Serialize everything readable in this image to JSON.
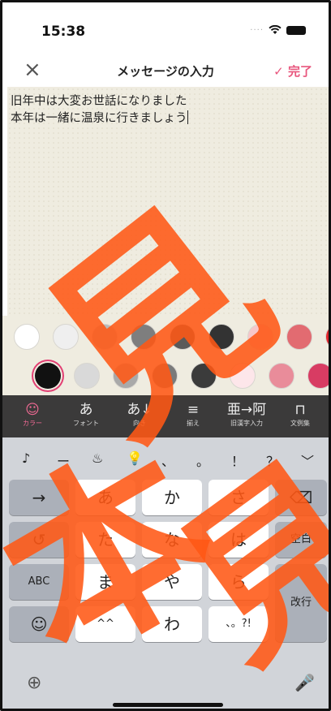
{
  "status_bar": {
    "time": "15:38"
  },
  "nav": {
    "close_icon": "×",
    "title": "メッセージの入力",
    "done_check": "✓",
    "done_label": "完了"
  },
  "editor": {
    "lines": [
      "旧年中は大変お世話になりました",
      "本年は一緒に温泉に行きましょう"
    ]
  },
  "palette": {
    "row1": [
      "#ffffff",
      "#efefef",
      "#b9b9b9",
      "#7e7e7e",
      "#5a5a5a",
      "#333333",
      "#f7c6c9",
      "#e26b71",
      "#e2262c"
    ],
    "row2": [
      "#111111",
      "#d9d9d9",
      "#a9a9a9",
      "#7a7a7a",
      "#3b3b3b",
      "#fde6ea",
      "#e98c9a",
      "#d83c63"
    ],
    "selected_row2_index": 0
  },
  "toolbar": {
    "items": [
      {
        "icon": "palette-icon",
        "glyph": "☺",
        "label": "カラー",
        "active": true
      },
      {
        "icon": "font-icon",
        "glyph": "あ",
        "label": "フォント",
        "active": false
      },
      {
        "icon": "direction-icon",
        "glyph": "あ↓",
        "label": "向き",
        "active": false
      },
      {
        "icon": "align-icon",
        "glyph": "≡",
        "label": "揃え",
        "active": false
      },
      {
        "icon": "kanji-icon",
        "glyph": "亜→阿",
        "label": "旧漢字入力",
        "active": false
      },
      {
        "icon": "dictionary-icon",
        "glyph": "⊓",
        "label": "文例集",
        "active": false
      }
    ]
  },
  "keyboard": {
    "candidates": [
      "♪",
      "ー",
      "♨",
      "💡",
      "、",
      "。",
      "！",
      "？",
      "﹀"
    ],
    "keys": {
      "arrow": "→",
      "a": "あ",
      "ka": "か",
      "sa": "さ",
      "backspace": "⌫",
      "undo": "↺",
      "ta": "た",
      "na": "な",
      "ha": "は",
      "space": "空白",
      "abc": "ABC",
      "ma": "ま",
      "ya": "や",
      "ra": "ら",
      "enter": "改行",
      "emoji": "☺",
      "dakuten": "^^",
      "wa": "わ",
      "punct": "、。?!",
      "globe": "⊕",
      "mic": "🎤"
    }
  },
  "watermark": {
    "glyphs": [
      "見",
      "本"
    ]
  }
}
